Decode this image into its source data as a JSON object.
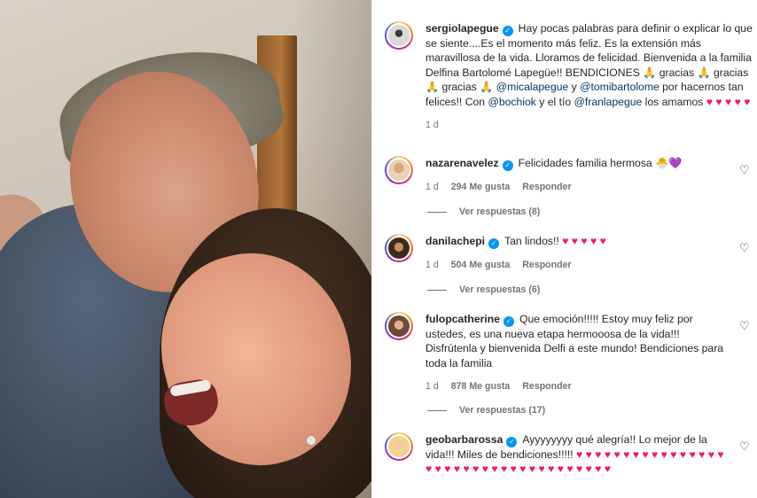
{
  "post": {
    "user": "sergiolapegue",
    "caption_parts": [
      {
        "t": "Hay pocas palabras para definir o explicar lo que se siente....Es el momento más feliz. Es la extensión más maravillosa de la vida. Lloramos de felicidad. Bienvenida a la familia Delfina Bartolomé Lapegüe!! BENDICIONES 🙏 gracias 🙏 gracias 🙏 gracias 🙏 ",
        "m": false
      },
      {
        "t": "@micalapegue",
        "m": true
      },
      {
        "t": " y ",
        "m": false
      },
      {
        "t": "@tomibartolome",
        "m": true
      },
      {
        "t": " por hacernos tan felices!! Con ",
        "m": false
      },
      {
        "t": "@bochiok",
        "m": true
      },
      {
        "t": " y el tío ",
        "m": false
      },
      {
        "t": "@franlapegue",
        "m": true
      },
      {
        "t": " los amamos",
        "m": false
      }
    ],
    "caption_hearts": "♥ ♥ ♥ ♥ ♥",
    "time": "1 d"
  },
  "comments": [
    {
      "user": "nazarenavelez",
      "text": "Felicidades familia hermosa 🐣💜",
      "hearts": "",
      "time": "1 d",
      "likes": "294 Me gusta",
      "reply": "Responder",
      "view_replies": "Ver respuestas (8)"
    },
    {
      "user": "danilachepi",
      "text": "Tan lindos!! ",
      "hearts": "♥ ♥ ♥ ♥ ♥",
      "time": "1 d",
      "likes": "504 Me gusta",
      "reply": "Responder",
      "view_replies": "Ver respuestas (6)"
    },
    {
      "user": "fulopcatherine",
      "text": "Que emoción!!!!! Estoy muy feliz por ustedes, es una nueva etapa hermooosa de la vida!!! Disfrútenla y bienvenida Delfi a este mundo! Bendiciones para toda la familia",
      "hearts": "",
      "time": "1 d",
      "likes": "878 Me gusta",
      "reply": "Responder",
      "view_replies": "Ver respuestas (17)"
    },
    {
      "user": "geobarbarossa",
      "text": "Ayyyyyyyy qué alegría!! Lo mejor de la vida!!! Miles de bendiciones!!!!! ",
      "hearts": "♥ ♥ ♥ ♥ ♥ ♥ ♥ ♥ ♥ ♥ ♥ ♥ ♥ ♥ ♥ ♥ ♥ ♥ ♥ ♥ ♥ ♥ ♥ ♥ ♥ ♥ ♥ ♥ ♥ ♥ ♥ ♥ ♥ ♥ ♥ ♥",
      "time": "",
      "likes": "",
      "reply": "",
      "view_replies": ""
    }
  ]
}
